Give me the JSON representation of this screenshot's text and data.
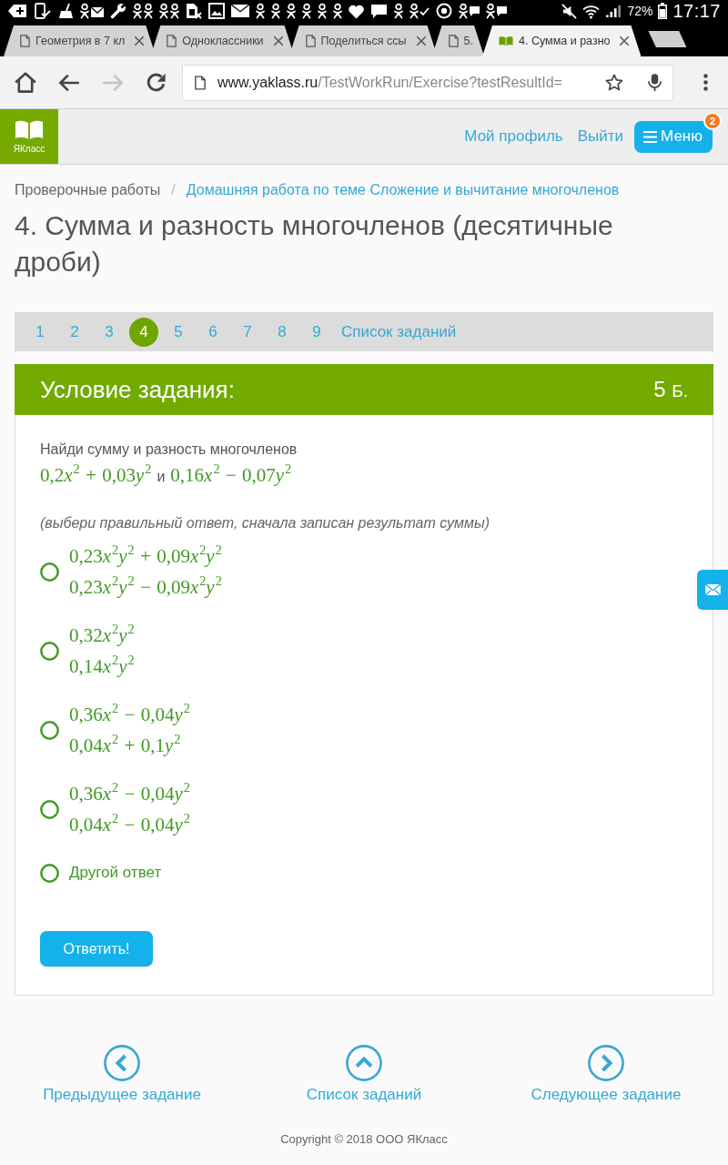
{
  "status_bar": {
    "battery": "72%",
    "time": "17:17"
  },
  "tabs": [
    {
      "kind": "page",
      "title": "Геометрия в 7 кл",
      "selected": false
    },
    {
      "kind": "page",
      "title": "Одноклассники",
      "selected": false
    },
    {
      "kind": "page",
      "title": "Поделиться ссы",
      "selected": false
    },
    {
      "kind": "stacked",
      "title": "5.",
      "selected": false
    },
    {
      "kind": "site",
      "title": "4. Сумма и разно",
      "selected": true
    }
  ],
  "toolbar": {
    "nav_buttons": [
      {
        "kind": "home",
        "disabled": false
      },
      {
        "kind": "back",
        "disabled": false
      },
      {
        "kind": "forward",
        "disabled": true
      },
      {
        "kind": "reload",
        "disabled": false
      }
    ],
    "address": {
      "host": "www.yaklass.ru",
      "path": "/TestWorkRun/Exercise?testResultId="
    }
  },
  "header": {
    "logo_text": "ЯКласс",
    "links": [
      "Мой профиль",
      "Выйти"
    ],
    "menu": {
      "label": "Меню",
      "badge": "2"
    }
  },
  "breadcrumb": {
    "items": [
      {
        "kind": "plain",
        "label": "Проверочные работы"
      },
      {
        "kind": "link",
        "label": "Домашняя работа по теме Сложение и вычитание многочленов"
      }
    ],
    "separator": "/"
  },
  "title": "4. Сумма и разность многочленов (десятичные дроби)",
  "pager": {
    "pages": [
      {
        "label": "1",
        "selected": false
      },
      {
        "label": "2",
        "selected": false
      },
      {
        "label": "3",
        "selected": false
      },
      {
        "label": "4",
        "selected": true
      },
      {
        "label": "5",
        "selected": false
      },
      {
        "label": "6",
        "selected": false
      },
      {
        "label": "7",
        "selected": false
      },
      {
        "label": "8",
        "selected": false
      },
      {
        "label": "9",
        "selected": false
      }
    ],
    "list_link": "Список заданий"
  },
  "task": {
    "heading": "Условие задания:",
    "points": "5",
    "points_unit": "Б.",
    "text": "Найди сумму и разность многочленов",
    "polynomials": [
      {
        "terms": [
          {
            "coef": "0,2",
            "factors": [
              {
                "var": "x",
                "power": "2"
              }
            ]
          },
          {
            "sign": "+",
            "coef": "0,03",
            "factors": [
              {
                "var": "y",
                "power": "2"
              }
            ]
          }
        ]
      },
      {
        "terms": [
          {
            "coef": "0,16",
            "factors": [
              {
                "var": "x",
                "power": "2"
              }
            ]
          },
          {
            "sign": "−",
            "coef": "0,07",
            "factors": [
              {
                "var": "y",
                "power": "2"
              }
            ]
          }
        ]
      }
    ],
    "conjunction": "и",
    "hint": "(выбери правильный ответ, сначала записан результат суммы)",
    "options": [
      {
        "kind": "math",
        "selected": false,
        "lines": [
          {
            "terms": [
              {
                "coef": "0,23",
                "factors": [
                  {
                    "var": "x",
                    "power": "2"
                  },
                  {
                    "var": "y",
                    "power": "2"
                  }
                ]
              },
              {
                "sign": "+",
                "coef": "0,09",
                "factors": [
                  {
                    "var": "x",
                    "power": "2"
                  },
                  {
                    "var": "y",
                    "power": "2"
                  }
                ]
              }
            ]
          },
          {
            "terms": [
              {
                "coef": "0,23",
                "factors": [
                  {
                    "var": "x",
                    "power": "2"
                  },
                  {
                    "var": "y",
                    "power": "2"
                  }
                ]
              },
              {
                "sign": "−",
                "coef": "0,09",
                "factors": [
                  {
                    "var": "x",
                    "power": "2"
                  },
                  {
                    "var": "y",
                    "power": "2"
                  }
                ]
              }
            ]
          }
        ]
      },
      {
        "kind": "math",
        "selected": false,
        "lines": [
          {
            "terms": [
              {
                "coef": "0,32",
                "factors": [
                  {
                    "var": "x",
                    "power": "2"
                  },
                  {
                    "var": "y",
                    "power": "2"
                  }
                ]
              }
            ]
          },
          {
            "terms": [
              {
                "coef": "0,14",
                "factors": [
                  {
                    "var": "x",
                    "power": "2"
                  },
                  {
                    "var": "y",
                    "power": "2"
                  }
                ]
              }
            ]
          }
        ]
      },
      {
        "kind": "math",
        "selected": false,
        "lines": [
          {
            "terms": [
              {
                "coef": "0,36",
                "factors": [
                  {
                    "var": "x",
                    "power": "2"
                  }
                ]
              },
              {
                "sign": "−",
                "coef": "0,04",
                "factors": [
                  {
                    "var": "y",
                    "power": "2"
                  }
                ]
              }
            ]
          },
          {
            "terms": [
              {
                "coef": "0,04",
                "factors": [
                  {
                    "var": "x",
                    "power": "2"
                  }
                ]
              },
              {
                "sign": "+",
                "coef": "0,1",
                "factors": [
                  {
                    "var": "y",
                    "power": "2"
                  }
                ]
              }
            ]
          }
        ]
      },
      {
        "kind": "math",
        "selected": false,
        "lines": [
          {
            "terms": [
              {
                "coef": "0,36",
                "factors": [
                  {
                    "var": "x",
                    "power": "2"
                  }
                ]
              },
              {
                "sign": "−",
                "coef": "0,04",
                "factors": [
                  {
                    "var": "y",
                    "power": "2"
                  }
                ]
              }
            ]
          },
          {
            "terms": [
              {
                "coef": "0,04",
                "factors": [
                  {
                    "var": "x",
                    "power": "2"
                  }
                ]
              },
              {
                "sign": "−",
                "coef": "0,04",
                "factors": [
                  {
                    "var": "y",
                    "power": "2"
                  }
                ]
              }
            ]
          }
        ]
      },
      {
        "kind": "text",
        "selected": false,
        "label": "Другой ответ"
      }
    ],
    "submit": "Ответить!"
  },
  "footer": {
    "links": [
      {
        "kind": "prev",
        "label": "Предыдущее задание"
      },
      {
        "kind": "up",
        "label": "Список заданий"
      },
      {
        "kind": "next",
        "label": "Следующее задание"
      }
    ],
    "copyright": "Copyright © 2018 ООО ЯКласс"
  }
}
